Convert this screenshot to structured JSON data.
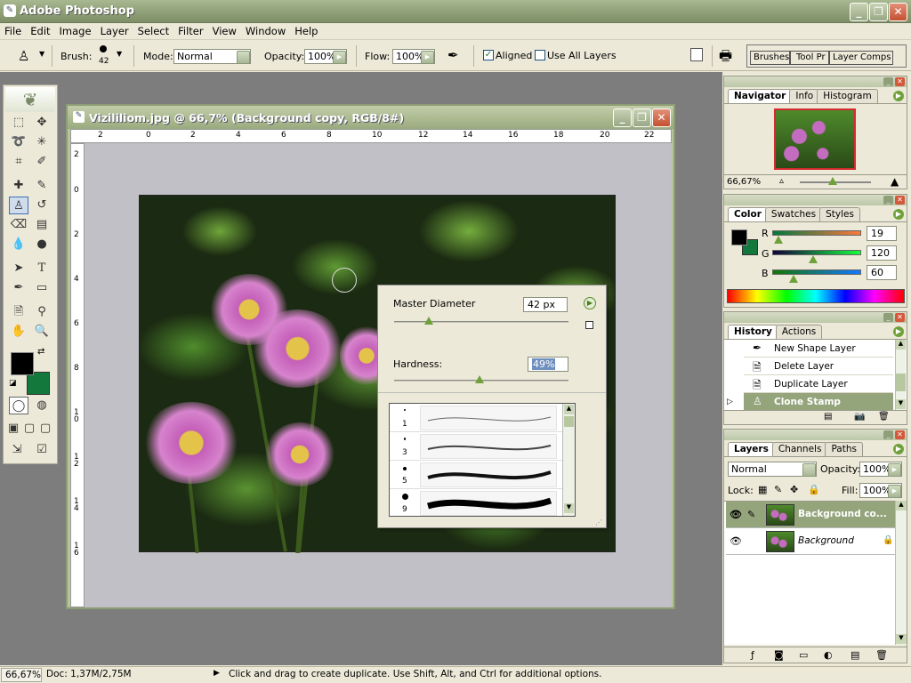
{
  "app": {
    "title": "Adobe Photoshop"
  },
  "window_buttons": {
    "min": "_",
    "max": "❐",
    "close": "✕"
  },
  "menubar": [
    "File",
    "Edit",
    "Image",
    "Layer",
    "Select",
    "Filter",
    "View",
    "Window",
    "Help"
  ],
  "options": {
    "brush_label": "Brush:",
    "brush_size": "42",
    "mode_label": "Mode:",
    "mode_value": "Normal",
    "opacity_label": "Opacity:",
    "opacity_value": "100%",
    "flow_label": "Flow:",
    "flow_value": "100%",
    "aligned_label": "Aligned",
    "aligned_checked": true,
    "use_all_layers_label": "Use All Layers",
    "use_all_layers_checked": false,
    "well_tabs": [
      "Brushes",
      "Tool Pr",
      "Layer Comps"
    ]
  },
  "document": {
    "title": "Vizililiom.jpg @ 66,7% (Background copy, RGB/8#)",
    "ruler_h": [
      "2",
      "0",
      "2",
      "4",
      "6",
      "8",
      "10",
      "12",
      "14",
      "16",
      "18",
      "20",
      "22"
    ],
    "ruler_v": [
      "2",
      "0",
      "2",
      "4",
      "6",
      "8",
      "1 0",
      "1 2",
      "1 4",
      "1 6"
    ]
  },
  "brush_popup": {
    "master_label": "Master Diameter",
    "master_value": "42 px",
    "master_level": 0.2,
    "hardness_label": "Hardness:",
    "hardness_value": "49%",
    "hardness_level": 0.49,
    "brushes": [
      "1",
      "3",
      "5",
      "9"
    ]
  },
  "navigator": {
    "tabs": [
      "Navigator",
      "Info",
      "Histogram"
    ],
    "zoom": "66,67%"
  },
  "color": {
    "tabs": [
      "Color",
      "Swatches",
      "Styles"
    ],
    "r_label": "R",
    "r_value": "19",
    "g_label": "G",
    "g_value": "120",
    "b_label": "B",
    "b_value": "60",
    "foreground": "#13783c",
    "background": "#000000"
  },
  "history": {
    "tabs": [
      "History",
      "Actions"
    ],
    "items": [
      "New Shape Layer",
      "Delete Layer",
      "Duplicate Layer",
      "Clone Stamp"
    ]
  },
  "layers": {
    "tabs": [
      "Layers",
      "Channels",
      "Paths"
    ],
    "blend": "Normal",
    "opacity_label": "Opacity:",
    "opacity_value": "100%",
    "lock_label": "Lock:",
    "fill_label": "Fill:",
    "fill_value": "100%",
    "items": [
      "Background co...",
      "Background"
    ]
  },
  "status": {
    "zoom": "66,67%",
    "doc": "Doc: 1,37M/2,75M",
    "hint": "Click and drag to create duplicate.  Use Shift, Alt, and Ctrl for additional options."
  }
}
